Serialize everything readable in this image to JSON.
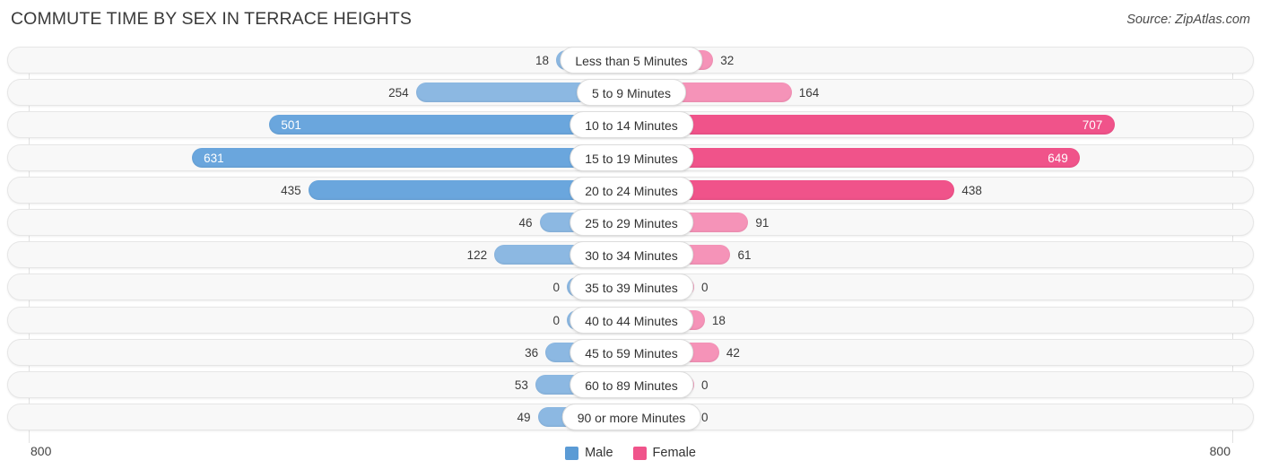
{
  "header": {
    "title": "COMMUTE TIME BY SEX IN TERRACE HEIGHTS",
    "source": "Source: ZipAtlas.com"
  },
  "axis": {
    "left_label": "800",
    "right_label": "800"
  },
  "legend": {
    "items": [
      {
        "label": "Male",
        "color": "#5b9bd5"
      },
      {
        "label": "Female",
        "color": "#f0548b"
      }
    ]
  },
  "colors": {
    "male_light": "#8cb8e2",
    "male_strong": "#6aa6dd",
    "female_light": "#f593b8",
    "female_strong": "#f0538a",
    "track": "#f8f8f8",
    "gridline": "#e2e2e2"
  },
  "chart_data": {
    "type": "bar",
    "orientation": "horizontal-diverging",
    "title": "COMMUTE TIME BY SEX IN TERRACE HEIGHTS",
    "xlabel": "",
    "ylabel": "",
    "xlim": [
      800,
      800
    ],
    "grid": true,
    "legend_position": "bottom-center",
    "categories": [
      "Less than 5 Minutes",
      "5 to 9 Minutes",
      "10 to 14 Minutes",
      "15 to 19 Minutes",
      "20 to 24 Minutes",
      "25 to 29 Minutes",
      "30 to 34 Minutes",
      "35 to 39 Minutes",
      "40 to 44 Minutes",
      "45 to 59 Minutes",
      "60 to 89 Minutes",
      "90 or more Minutes"
    ],
    "series": [
      {
        "name": "Male",
        "values": [
          18,
          254,
          501,
          631,
          435,
          46,
          122,
          0,
          0,
          36,
          53,
          49
        ]
      },
      {
        "name": "Female",
        "values": [
          32,
          164,
          707,
          649,
          438,
          91,
          61,
          0,
          18,
          42,
          0,
          0
        ]
      }
    ]
  },
  "rows": [
    {
      "category": "Less than 5 Minutes",
      "male": "18",
      "female": "32",
      "male_value": 18,
      "female_value": 32,
      "male_inside": false,
      "female_inside": false,
      "male_strong": false,
      "female_strong": false
    },
    {
      "category": "5 to 9 Minutes",
      "male": "254",
      "female": "164",
      "male_value": 254,
      "female_value": 164,
      "male_inside": false,
      "female_inside": false,
      "male_strong": false,
      "female_strong": false
    },
    {
      "category": "10 to 14 Minutes",
      "male": "501",
      "female": "707",
      "male_value": 501,
      "female_value": 707,
      "male_inside": true,
      "female_inside": true,
      "male_strong": true,
      "female_strong": true
    },
    {
      "category": "15 to 19 Minutes",
      "male": "631",
      "female": "649",
      "male_value": 631,
      "female_value": 649,
      "male_inside": true,
      "female_inside": true,
      "male_strong": true,
      "female_strong": true
    },
    {
      "category": "20 to 24 Minutes",
      "male": "435",
      "female": "438",
      "male_value": 435,
      "female_value": 438,
      "male_inside": false,
      "female_inside": false,
      "male_strong": true,
      "female_strong": true
    },
    {
      "category": "25 to 29 Minutes",
      "male": "46",
      "female": "91",
      "male_value": 46,
      "female_value": 91,
      "male_inside": false,
      "female_inside": false,
      "male_strong": false,
      "female_strong": false
    },
    {
      "category": "30 to 34 Minutes",
      "male": "122",
      "female": "61",
      "male_value": 122,
      "female_value": 61,
      "male_inside": false,
      "female_inside": false,
      "male_strong": false,
      "female_strong": false
    },
    {
      "category": "35 to 39 Minutes",
      "male": "0",
      "female": "0",
      "male_value": 0,
      "female_value": 0,
      "male_inside": false,
      "female_inside": false,
      "male_strong": false,
      "female_strong": false
    },
    {
      "category": "40 to 44 Minutes",
      "male": "0",
      "female": "18",
      "male_value": 0,
      "female_value": 18,
      "male_inside": false,
      "female_inside": false,
      "male_strong": false,
      "female_strong": false
    },
    {
      "category": "45 to 59 Minutes",
      "male": "36",
      "female": "42",
      "male_value": 36,
      "female_value": 42,
      "male_inside": false,
      "female_inside": false,
      "male_strong": false,
      "female_strong": false
    },
    {
      "category": "60 to 89 Minutes",
      "male": "53",
      "female": "0",
      "male_value": 53,
      "female_value": 0,
      "male_inside": false,
      "female_inside": false,
      "male_strong": false,
      "female_strong": false
    },
    {
      "category": "90 or more Minutes",
      "male": "49",
      "female": "0",
      "male_value": 49,
      "female_value": 0,
      "male_inside": false,
      "female_inside": false,
      "male_strong": false,
      "female_strong": false
    }
  ]
}
